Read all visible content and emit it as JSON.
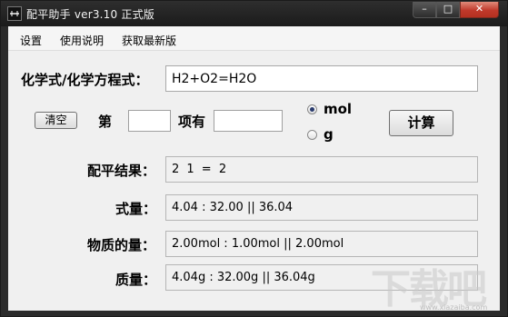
{
  "window": {
    "title": "配平助手 ver3.10 正式版",
    "controls": {
      "minimize": "–",
      "maximize": "□",
      "close": "✕"
    }
  },
  "menu": {
    "items": [
      "设置",
      "使用说明",
      "获取最新版"
    ]
  },
  "formula": {
    "label": "化学式/化学方程式：",
    "value": "H2+O2=H2O"
  },
  "controls": {
    "clear_label": "清空",
    "term_prefix": "第",
    "term_suffix": "项有",
    "term_index_value": "",
    "term_amount_value": "",
    "unit_mol": "mol",
    "unit_g": "g",
    "unit_selected": "mol",
    "calc_label": "计算"
  },
  "results": {
    "coeff_label": "配平结果：",
    "coeff_value": "2 1 = 2",
    "formula_weight_label": "式量：",
    "formula_weight_value": "4.04 : 32.00 ||  36.04",
    "amount_label": "物质的量：",
    "amount_value": "2.00mol : 1.00mol || 2.00mol",
    "mass_label": "质量：",
    "mass_value": "4.04g : 32.00g || 36.04g"
  },
  "watermark": {
    "text": "下载吧",
    "url": "www.xiazaiba.com"
  },
  "colors": {
    "titlebar": "#1b1b1b",
    "client_bg": "#f0f0f0",
    "close_button": "#c0392b"
  }
}
